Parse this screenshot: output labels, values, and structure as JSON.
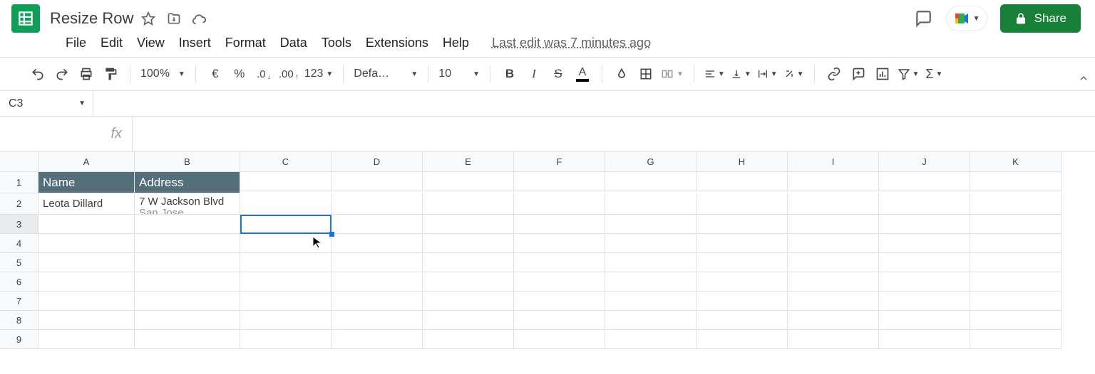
{
  "doc": {
    "title": "Resize Row"
  },
  "menus": {
    "file": "File",
    "edit": "Edit",
    "view": "View",
    "insert": "Insert",
    "format": "Format",
    "data": "Data",
    "tools": "Tools",
    "extensions": "Extensions",
    "help": "Help",
    "lastEdit": "Last edit was 7 minutes ago"
  },
  "toolbar": {
    "zoom": "100%",
    "currency": "€",
    "percent": "%",
    "moreFormats": "123",
    "font": "Default (Ari…",
    "fontSize": "10",
    "bold": "B",
    "italic": "I",
    "strike": "S",
    "textColorLetter": "A",
    "functions": "Σ"
  },
  "namebox": {
    "ref": "C3"
  },
  "formula": {
    "fx": "fx",
    "content": ""
  },
  "columns": [
    "A",
    "B",
    "C",
    "D",
    "E",
    "F",
    "G",
    "H",
    "I",
    "J",
    "K"
  ],
  "rowNums": [
    "1",
    "2",
    "3",
    "4",
    "5",
    "6",
    "7",
    "8",
    "9"
  ],
  "cells": {
    "A1": "Name",
    "B1": "Address",
    "A2": "Leota Dillard",
    "B2_line1": "7 W Jackson Blvd",
    "B2_line2": "San Jose"
  },
  "share": {
    "label": "Share"
  },
  "selection": {
    "cell": "C3"
  }
}
